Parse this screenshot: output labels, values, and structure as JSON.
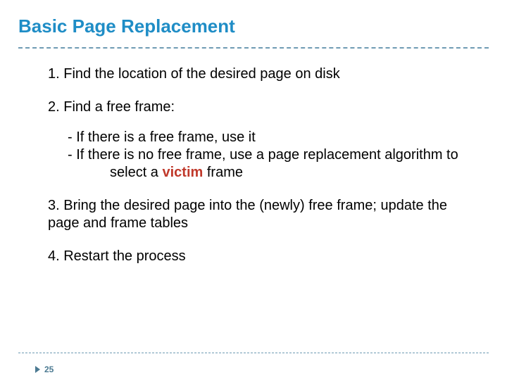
{
  "title": "Basic Page Replacement",
  "steps": {
    "s1": "1. Find the location of the desired page on disk",
    "s2": "2. Find a free frame:",
    "s2a": "-  If there is a free frame, use it",
    "s2b": "-  If there is no free frame, use a page replacement algorithm to",
    "s2b_cont": "select a ",
    "s2b_victim": "victim",
    "s2b_tail": " frame",
    "s3": "3. Bring  the desired page into the (newly) free frame; update the page and frame tables",
    "s4": "4. Restart the process"
  },
  "page_number": "25"
}
